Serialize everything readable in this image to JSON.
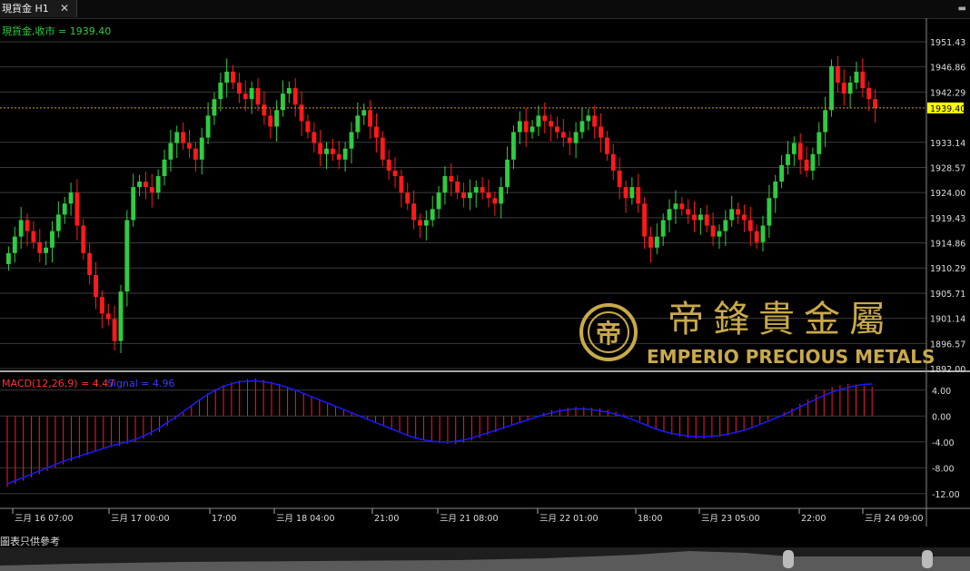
{
  "tab": {
    "title": "現貨金 H1",
    "close": "✕"
  },
  "menu_icon": "dropdown-arrow-icon",
  "price_label": "現貨金,收市 = 1939.40",
  "macd_label": "MACD(12,26,9) = 4.47",
  "signal_label": "Signal = 4.96",
  "current_price": "1939.40",
  "price_axis": [
    "1951.43",
    "1946.86",
    "1942.29",
    "1939.40",
    "1933.14",
    "1928.57",
    "1924.00",
    "1919.43",
    "1914.86",
    "1910.29",
    "1905.71",
    "1901.14",
    "1896.57",
    "1892.00"
  ],
  "macd_axis": [
    "4.00",
    "0.00",
    "-4.00",
    "-8.00",
    "-12.00"
  ],
  "time_axis": [
    "三月 16 07:00",
    "三月 17 00:00",
    "17:00",
    "三月 18 04:00",
    "21:00",
    "三月 21 08:00",
    "三月 22 01:00",
    "18:00",
    "三月 23 05:00",
    "22:00",
    "三月 24 09:00"
  ],
  "logo": {
    "chinese": "帝鋒貴金屬",
    "english": "EMPERIO PRECIOUS METALS"
  },
  "footer_note": "圖表只供參考",
  "colors": {
    "up": "#2ecc40",
    "down": "#ff1a1a",
    "signal": "#1a1aff",
    "grid": "#3a3a3a",
    "price_line": "#d4a017",
    "gold": "#c9a94a"
  },
  "chart_data": {
    "type": "candlestick",
    "series_price": "現貨金",
    "price_range": [
      1892.0,
      1951.43
    ],
    "last_close": 1939.4,
    "closes": [
      1913,
      1916,
      1919,
      1917,
      1915,
      1913,
      1914,
      1917,
      1920,
      1922,
      1924,
      1918,
      1913,
      1909,
      1905,
      1902,
      1901,
      1897,
      1906,
      1919,
      1925,
      1926,
      1925,
      1924,
      1927,
      1930,
      1933,
      1935,
      1933,
      1932,
      1930,
      1934,
      1938,
      1941,
      1944,
      1946,
      1944,
      1942,
      1941,
      1943,
      1940,
      1938,
      1936,
      1939,
      1942,
      1943,
      1940,
      1937,
      1935,
      1933,
      1931,
      1932,
      1931,
      1930,
      1932,
      1935,
      1938,
      1939,
      1936,
      1934,
      1930,
      1928,
      1927,
      1924,
      1922,
      1919,
      1918,
      1919,
      1921,
      1924,
      1927,
      1926,
      1924,
      1923,
      1924,
      1925,
      1924,
      1923,
      1922,
      1925,
      1930,
      1935,
      1937,
      1935,
      1936,
      1938,
      1937,
      1936,
      1935,
      1934,
      1933,
      1935,
      1937,
      1938,
      1936,
      1934,
      1931,
      1928,
      1925,
      1923,
      1925,
      1922,
      1916,
      1914,
      1916,
      1919,
      1921,
      1922,
      1921,
      1920,
      1919,
      1920,
      1918,
      1916,
      1917,
      1919,
      1921,
      1920,
      1919,
      1917,
      1915,
      1918,
      1923,
      1926,
      1929,
      1931,
      1933,
      1930,
      1928,
      1931,
      1935,
      1939,
      1947,
      1944,
      1942,
      1944,
      1946,
      1943,
      1941,
      1939.4
    ],
    "macd": [
      -11,
      -10.5,
      -10,
      -9.5,
      -9,
      -8.5,
      -8,
      -7.5,
      -7,
      -6.5,
      -6,
      -5.5,
      -5,
      -4.8,
      -4.6,
      -4.3,
      -4,
      -3.5,
      -3,
      -2.5,
      -1.5,
      -0.5,
      0.5,
      1.5,
      2.5,
      3.5,
      4.2,
      4.8,
      5.2,
      5.5,
      5.7,
      5.8,
      5.6,
      5.3,
      5,
      4.5,
      4,
      3.5,
      3,
      2.5,
      2,
      1.5,
      1,
      0.5,
      0,
      -0.5,
      -1,
      -1.5,
      -2,
      -2.5,
      -3,
      -3.4,
      -3.7,
      -4,
      -4.2,
      -4.3,
      -4.3,
      -4.1,
      -3.8,
      -3.4,
      -3,
      -2.5,
      -2,
      -1.5,
      -1,
      -0.5,
      0,
      0.5,
      0.9,
      1.1,
      1.3,
      1.4,
      1.4,
      1.3,
      1.2,
      1,
      0.7,
      0.3,
      -0.2,
      -0.8,
      -1.4,
      -2,
      -2.5,
      -2.9,
      -3.2,
      -3.4,
      -3.5,
      -3.5,
      -3.4,
      -3.2,
      -3,
      -2.7,
      -2.3,
      -1.8,
      -1.2,
      -0.6,
      0,
      0.6,
      1.2,
      1.9,
      2.6,
      3.3,
      4,
      4.5,
      4.8,
      5,
      4.9,
      4.7,
      4.5
    ],
    "signal": [
      -10.5,
      -10,
      -9.5,
      -9,
      -8.5,
      -8,
      -7.5,
      -7,
      -6.6,
      -6.2,
      -5.8,
      -5.4,
      -5,
      -4.6,
      -4.3,
      -4,
      -3.6,
      -3.1,
      -2.5,
      -1.8,
      -1,
      -0.2,
      0.7,
      1.6,
      2.5,
      3.3,
      4,
      4.6,
      5,
      5.3,
      5.4,
      5.4,
      5.3,
      5.1,
      4.8,
      4.4,
      4,
      3.5,
      3,
      2.5,
      2,
      1.5,
      1,
      0.5,
      0,
      -0.5,
      -1,
      -1.5,
      -2,
      -2.5,
      -3,
      -3.4,
      -3.7,
      -3.9,
      -4,
      -4,
      -3.9,
      -3.7,
      -3.4,
      -3,
      -2.6,
      -2.2,
      -1.8,
      -1.4,
      -1,
      -0.6,
      -0.2,
      0.2,
      0.5,
      0.8,
      1,
      1.1,
      1.1,
      1,
      0.8,
      0.6,
      0.3,
      -0.1,
      -0.5,
      -1,
      -1.5,
      -2,
      -2.4,
      -2.7,
      -2.9,
      -3.1,
      -3.2,
      -3.2,
      -3.1,
      -3,
      -2.8,
      -2.5,
      -2.2,
      -1.8,
      -1.3,
      -0.8,
      -0.3,
      0.2,
      0.8,
      1.4,
      2,
      2.6,
      3.2,
      3.7,
      4.1,
      4.4,
      4.7,
      4.9,
      4.96
    ],
    "macd_range": [
      -14,
      6.5
    ]
  }
}
